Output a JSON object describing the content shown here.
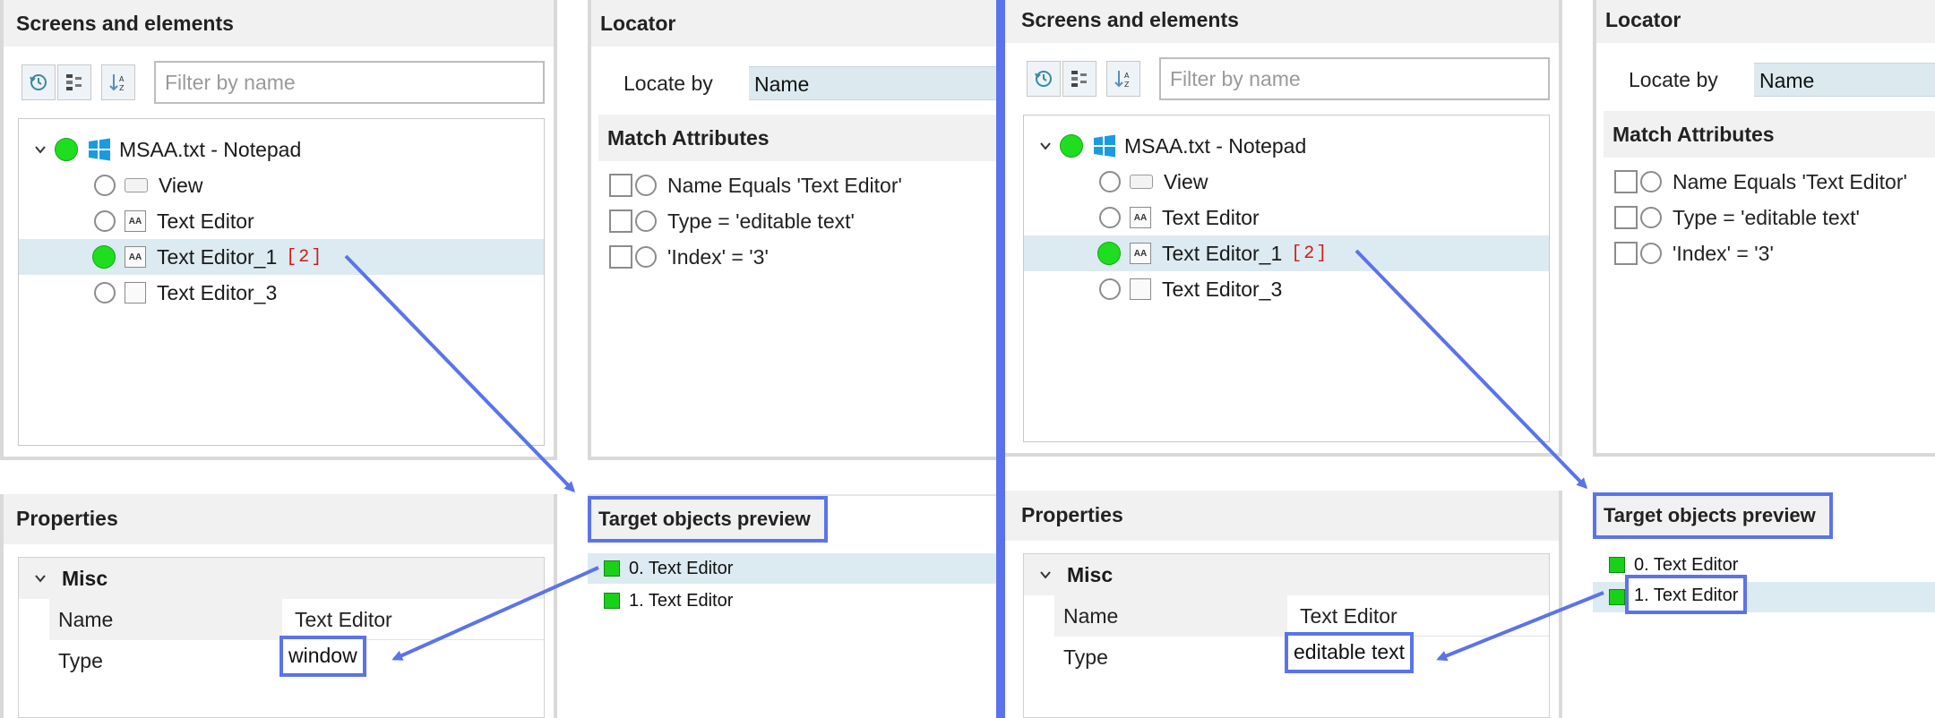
{
  "colors": {
    "accent": "#5b73ea",
    "selection": "#dcebf1",
    "status_green": "#1fdd1f",
    "badge_red": "#d21c1c"
  },
  "left": {
    "screens": {
      "title": "Screens and elements",
      "toolbar": {
        "history_icon": "history-icon",
        "hierarchy_icon": "hierarchy-icon",
        "sort_icon": "sort-icon"
      },
      "filter_placeholder": "Filter by name",
      "root": {
        "label": "MSAA.txt - Notepad",
        "icon": "windows-icon"
      },
      "items": [
        {
          "label": "View",
          "icon": "view-icon",
          "badge": ""
        },
        {
          "label": "Text Editor",
          "icon": "text-icon",
          "badge": ""
        },
        {
          "label": "Text Editor_1",
          "icon": "text-icon",
          "badge": "[2]"
        },
        {
          "label": "Text Editor_3",
          "icon": "blank-icon",
          "badge": ""
        }
      ]
    },
    "locator": {
      "title": "Locator",
      "locate_by_label": "Locate by",
      "locate_by_value": "Name",
      "match_title": "Match Attributes",
      "attributes": [
        "Name Equals 'Text Editor'",
        "Type = 'editable text'",
        "'Index' = '3'"
      ]
    },
    "properties": {
      "title": "Properties",
      "group": "Misc",
      "rows": [
        {
          "name": "Name",
          "value": "Text Editor"
        },
        {
          "name": "Type",
          "value": "window"
        }
      ]
    },
    "preview": {
      "title": "Target objects preview",
      "items": [
        "0. Text Editor",
        "1. Text Editor"
      ]
    }
  },
  "right": {
    "screens": {
      "title": "Screens and elements",
      "filter_placeholder": "Filter by name",
      "root": {
        "label": "MSAA.txt - Notepad"
      },
      "items": [
        {
          "label": "View",
          "badge": ""
        },
        {
          "label": "Text Editor",
          "badge": ""
        },
        {
          "label": "Text Editor_1",
          "badge": "[2]"
        },
        {
          "label": "Text Editor_3",
          "badge": ""
        }
      ]
    },
    "locator": {
      "title": "Locator",
      "locate_by_label": "Locate by",
      "locate_by_value": "Name",
      "match_title": "Match Attributes",
      "attributes": [
        "Name Equals 'Text Editor'",
        "Type = 'editable text'",
        "'Index' = '3'"
      ]
    },
    "properties": {
      "title": "Properties",
      "group": "Misc",
      "rows": [
        {
          "name": "Name",
          "value": "Text Editor"
        },
        {
          "name": "Type",
          "value": "editable text"
        }
      ]
    },
    "preview": {
      "title": "Target objects preview",
      "items": [
        "0. Text Editor",
        "1. Text Editor"
      ]
    }
  }
}
